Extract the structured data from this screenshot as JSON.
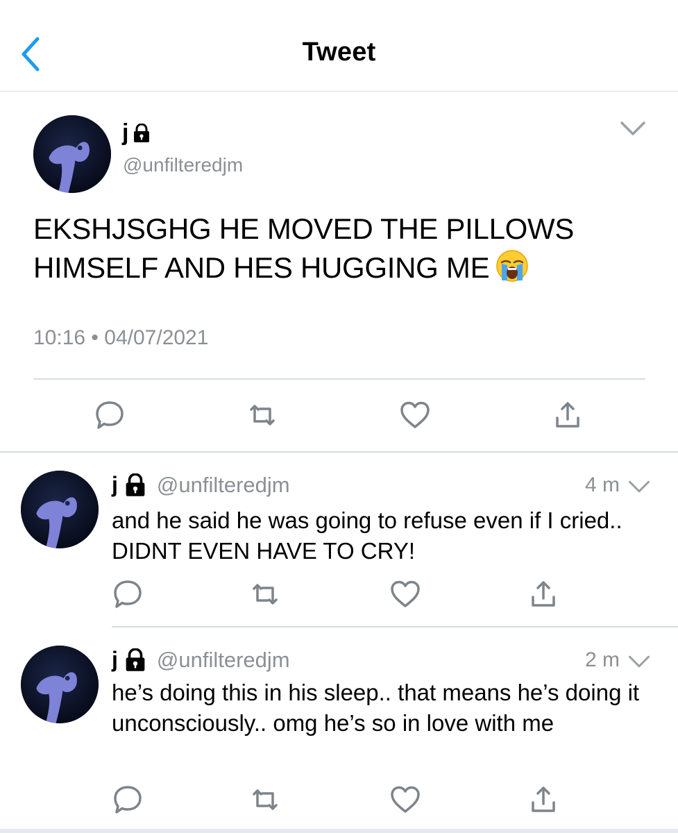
{
  "header": {
    "title": "Tweet"
  },
  "main_tweet": {
    "name": "j",
    "handle": "@unfilteredjm",
    "text": "EKSHJSGHG HE MOVED THE PILLOWS HIMSELF AND HES HUGGING ME",
    "time": "10:16",
    "separator": "•",
    "date": "04/07/2021"
  },
  "replies": [
    {
      "name": "j",
      "handle": "@unfilteredjm",
      "time": "4 m",
      "text": "and he said he was going to refuse even if I cried.. DIDNT EVEN HAVE TO CRY!"
    },
    {
      "name": "j",
      "handle": "@unfilteredjm",
      "time": "2 m",
      "text": "he’s doing this in his sleep.. that means he’s doing it unconsciously.. omg he’s so in love with me"
    }
  ],
  "icons": {
    "back": "chevron-left-icon",
    "lock": "lock-icon",
    "caret": "chevron-down-icon",
    "emoji": "loudly-crying-face-emoji",
    "reply": "reply-icon",
    "retweet": "retweet-icon",
    "like": "heart-icon",
    "share": "share-icon"
  },
  "colors": {
    "accent": "#1da1f2",
    "muted": "#8a9095",
    "divider": "#d9dcdf",
    "icon": "#7d848b"
  }
}
